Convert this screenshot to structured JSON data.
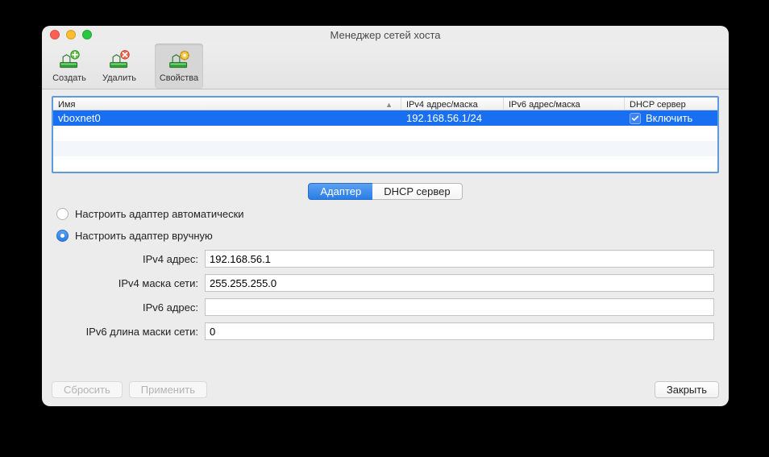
{
  "window": {
    "title": "Менеджер сетей хоста"
  },
  "toolbar": {
    "create": "Создать",
    "delete": "Удалить",
    "props": "Свойства"
  },
  "table": {
    "headers": {
      "name": "Имя",
      "ipv4": "IPv4 адрес/маска",
      "ipv6": "IPv6 адрес/маска",
      "dhcp": "DHCP сервер"
    },
    "rows": [
      {
        "name": "vboxnet0",
        "ipv4": "192.168.56.1/24",
        "ipv6": "",
        "dhcp_checked": true,
        "dhcp_label": "Включить"
      }
    ]
  },
  "tabs": {
    "adapter": "Адаптер",
    "dhcp": "DHCP сервер"
  },
  "adapter": {
    "auto_label": "Настроить адаптер автоматически",
    "manual_label": "Настроить адаптер вручную",
    "mode": "manual",
    "fields": {
      "ipv4_addr_label": "IPv4 адрес:",
      "ipv4_addr_value": "192.168.56.1",
      "ipv4_mask_label": "IPv4 маска сети:",
      "ipv4_mask_value": "255.255.255.0",
      "ipv6_addr_label": "IPv6 адрес:",
      "ipv6_addr_value": "",
      "ipv6_len_label": "IPv6 длина маски сети:",
      "ipv6_len_value": "0"
    }
  },
  "footer": {
    "reset": "Сбросить",
    "apply": "Применить",
    "close": "Закрыть"
  }
}
